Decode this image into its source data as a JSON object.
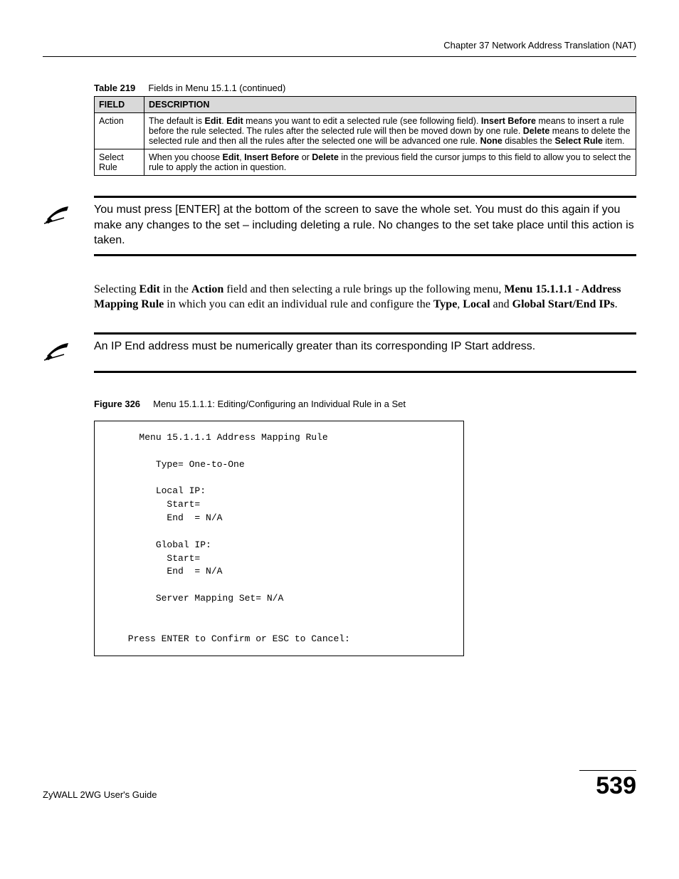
{
  "chapter_header": "Chapter 37 Network Address Translation (NAT)",
  "table_caption_prefix": "Table 219",
  "table_caption_rest": "Fields in Menu 15.1.1 (continued)",
  "table": {
    "headers": [
      "FIELD",
      "DESCRIPTION"
    ],
    "rows": [
      {
        "field": "Action",
        "desc_parts": {
          "t1": "The default is ",
          "b1": "Edit",
          "t2": ". ",
          "b2": "Edit",
          "t3": " means you want to edit a selected rule (see following field). ",
          "b3": "Insert Before",
          "t4": " means to insert a rule before the rule selected. The rules after the selected rule will then be moved down by one rule. ",
          "b4": "Delete",
          "t5": " means to delete the selected rule and then all the rules after the selected one will be advanced one rule. ",
          "b5": "None",
          "t6": " disables the ",
          "b6": "Select Rule",
          "t7": " item."
        }
      },
      {
        "field": "Select Rule",
        "desc_parts": {
          "t1": "When you choose ",
          "b1": "Edit",
          "t2": ", ",
          "b2": "Insert Before",
          "t3": " or ",
          "b3": "Delete",
          "t4": " in the previous field the cursor jumps to this field to allow you to select the rule to apply the action in question."
        }
      }
    ]
  },
  "note1": "You must press [ENTER] at the bottom of the screen to save the whole set. You must do this again if you make any changes to the set – including deleting a rule. No changes to the set take place until this action is taken.",
  "paragraph_parts": {
    "t1": "Selecting ",
    "b1": "Edit",
    "t2": " in the ",
    "b2": "Action",
    "t3": " field and then selecting a rule brings up the following menu, ",
    "b3": "Menu 15.1.1.1 - Address Mapping Rule",
    "t4": " in which you can edit an individual rule and configure the ",
    "b4": "Type",
    "t5": ", ",
    "b5": "Local",
    "t6": " and ",
    "b6": "Global Start/End IPs",
    "t7": "."
  },
  "note2": "An IP End address must be numerically greater than its corresponding IP Start address.",
  "figure_caption_prefix": "Figure 326",
  "figure_caption_rest": "Menu 15.1.1.1: Editing/Configuring an Individual Rule in a Set",
  "terminal": "        Menu 15.1.1.1 Address Mapping Rule\n\n           Type= One-to-One\n\n           Local IP:\n             Start=\n             End  = N/A\n\n           Global IP:\n             Start=\n             End  = N/A\n\n           Server Mapping Set= N/A\n\n\n      Press ENTER to Confirm or ESC to Cancel:",
  "footer_left": "ZyWALL 2WG User's Guide",
  "footer_right": "539"
}
